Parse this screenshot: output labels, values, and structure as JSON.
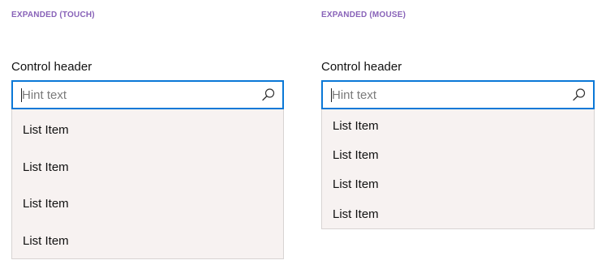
{
  "touch": {
    "section_label": "EXPANDED (TOUCH)",
    "control_header": "Control header",
    "hint_text": "Hint text",
    "items": [
      "List Item",
      "List Item",
      "List Item",
      "List Item"
    ]
  },
  "mouse": {
    "section_label": "EXPANDED (MOUSE)",
    "control_header": "Control header",
    "hint_text": "Hint text",
    "items": [
      "List Item",
      "List Item",
      "List Item",
      "List Item"
    ]
  },
  "colors": {
    "accent": "#0a78d7",
    "section_label": "#8862b8",
    "dropdown_background": "#f7f2f1"
  },
  "icons": {
    "search": "search-icon"
  }
}
